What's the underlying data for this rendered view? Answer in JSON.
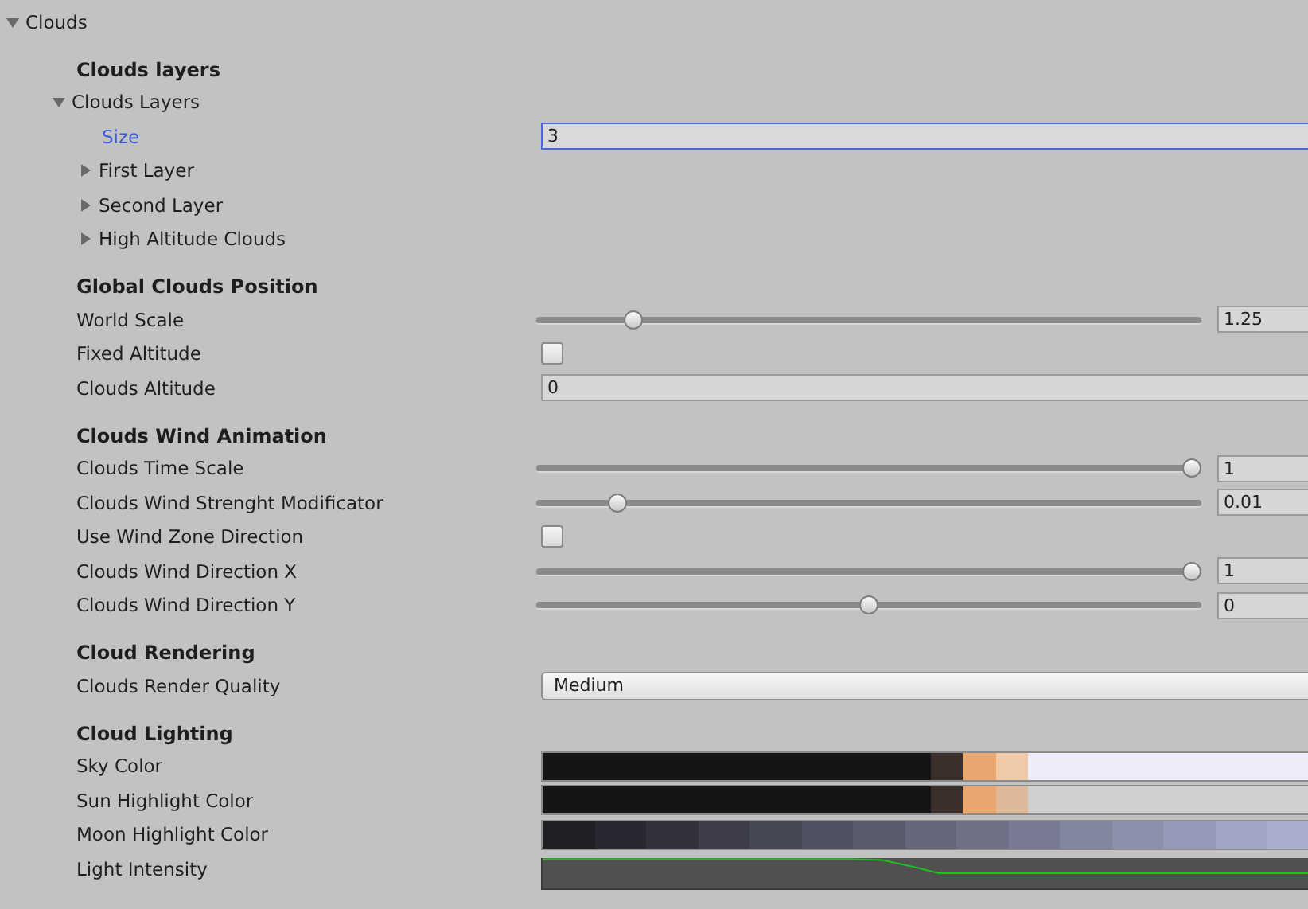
{
  "foldout": {
    "label": "Clouds",
    "expanded": true
  },
  "sections": [
    {
      "header": "Clouds layers",
      "rows": [
        {
          "kind": "foldout",
          "label": "Clouds Layers",
          "expanded": true,
          "children": [
            {
              "kind": "text",
              "label": "Size",
              "value": "3",
              "focused": true
            },
            {
              "kind": "foldout",
              "label": "First Layer",
              "expanded": false
            },
            {
              "kind": "foldout",
              "label": "Second Layer",
              "expanded": false
            },
            {
              "kind": "foldout",
              "label": "High Altitude Clouds",
              "expanded": false
            }
          ]
        }
      ]
    },
    {
      "header": "Global Clouds Position",
      "rows": [
        {
          "kind": "slider",
          "label": "World Scale",
          "level": 0.136,
          "value": "1.25"
        },
        {
          "kind": "checkbox",
          "label": "Fixed Altitude",
          "checked": false
        },
        {
          "kind": "text",
          "label": "Clouds Altitude",
          "value": "0",
          "focused": false
        }
      ]
    },
    {
      "header": "Clouds Wind Animation",
      "rows": [
        {
          "kind": "slider",
          "label": "Clouds Time Scale",
          "level": 1,
          "value": "1"
        },
        {
          "kind": "slider",
          "label": "Clouds Wind Strenght Modificator",
          "level": 0.11,
          "value": "0.01"
        },
        {
          "kind": "checkbox",
          "label": "Use Wind Zone Direction",
          "checked": false
        },
        {
          "kind": "slider",
          "label": "Clouds Wind Direction X",
          "level": 1,
          "value": "1"
        },
        {
          "kind": "slider",
          "label": "Clouds Wind Direction Y",
          "level": 0.5,
          "value": "0"
        }
      ]
    },
    {
      "header": "Cloud Rendering",
      "rows": [
        {
          "kind": "dropdown",
          "label": "Clouds Render Quality",
          "value": "Medium"
        }
      ]
    },
    {
      "header": "Cloud Lighting",
      "rows": [
        {
          "kind": "gradient",
          "label": "Sky Color",
          "stops": [
            {
              "color": "#151518"
            },
            {
              "color": "#151518"
            },
            {
              "color": "#151518"
            },
            {
              "color": "#151518"
            },
            {
              "color": "#151518"
            },
            {
              "color": "#151518"
            },
            {
              "color": "#151518"
            },
            {
              "color": "#151518"
            },
            {
              "color": "#151518"
            },
            {
              "color": "#151518"
            },
            {
              "color": "#151518"
            },
            {
              "color": "#151518"
            },
            {
              "color": "#3a2f2a"
            },
            {
              "color": "#e9a66f"
            },
            {
              "color": "#f0c9a8"
            },
            {
              "color": "#ececfb"
            },
            {
              "color": "#ececfb"
            },
            {
              "color": "#ececfb"
            },
            {
              "color": "#ececfb"
            },
            {
              "color": "#ececfb"
            },
            {
              "color": "#ececfb"
            },
            {
              "color": "#ececfb"
            },
            {
              "color": "#ececfb"
            },
            {
              "color": "#ececfb"
            }
          ]
        },
        {
          "kind": "gradient",
          "label": "Sun Highlight Color",
          "stops": [
            {
              "color": "#151518"
            },
            {
              "color": "#151518"
            },
            {
              "color": "#151518"
            },
            {
              "color": "#151518"
            },
            {
              "color": "#151518"
            },
            {
              "color": "#151518"
            },
            {
              "color": "#151518"
            },
            {
              "color": "#151518"
            },
            {
              "color": "#151518"
            },
            {
              "color": "#151518"
            },
            {
              "color": "#151518"
            },
            {
              "color": "#151518"
            },
            {
              "color": "#3a2f2a"
            },
            {
              "color": "#e9a66f"
            },
            {
              "color": "#deb999"
            },
            {
              "color": "#d0d0d0"
            },
            {
              "color": "#d0d0d0"
            },
            {
              "color": "#d0d0d0"
            },
            {
              "color": "#d0d0d0"
            },
            {
              "color": "#d0d0d0"
            },
            {
              "color": "#d0d0d0"
            },
            {
              "color": "#d0d0d0"
            },
            {
              "color": "#d0d0d0"
            },
            {
              "color": "#d0d0d0"
            }
          ]
        },
        {
          "kind": "gradient",
          "label": "Moon Highlight Color",
          "stops": [
            {
              "color": "#1f1f25"
            },
            {
              "color": "#282830"
            },
            {
              "color": "#32323c"
            },
            {
              "color": "#3c3d48"
            },
            {
              "color": "#464754"
            },
            {
              "color": "#505161"
            },
            {
              "color": "#5a5c6d"
            },
            {
              "color": "#64667a"
            },
            {
              "color": "#6e7186"
            },
            {
              "color": "#787b93"
            },
            {
              "color": "#82869f"
            },
            {
              "color": "#8c90ac"
            },
            {
              "color": "#969ab8"
            },
            {
              "color": "#a0a5c5"
            },
            {
              "color": "#a9aecd"
            }
          ]
        },
        {
          "kind": "curve",
          "label": "Light Intensity"
        }
      ]
    }
  ]
}
